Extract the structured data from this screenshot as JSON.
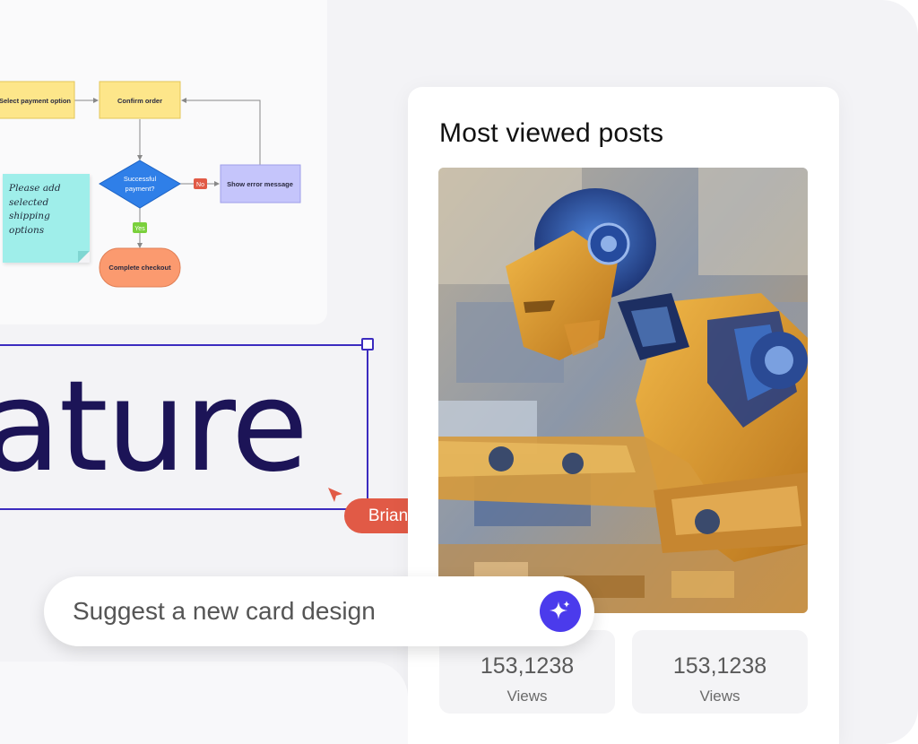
{
  "flowchart": {
    "nodes": {
      "select_payment": "Select payment option",
      "confirm_order": "Confirm order",
      "successful_payment_line1": "Successful",
      "successful_payment_line2": "payment?",
      "show_error": "Show error message",
      "complete_checkout": "Complete checkout"
    },
    "labels": {
      "no": "No",
      "yes": "Yes"
    },
    "colors": {
      "yellow": "#fde68a",
      "blue_diamond": "#2f7fe8",
      "lavender": "#c5c5fb",
      "orange": "#fb9a6f",
      "no_badge": "#e15a46",
      "yes_badge": "#7ad03c"
    }
  },
  "sticky_note": {
    "text": "Please add\nselected shipping\noptions",
    "color": "#9feeea"
  },
  "canvas_text": {
    "value": "ature",
    "frame_color": "#3b2bbf"
  },
  "collaborator": {
    "name": "Brian",
    "color": "#e15a46"
  },
  "posts_card": {
    "title": "Most viewed posts",
    "image_icon": "robot-artwork-image",
    "stats": [
      {
        "value": "153,1238",
        "label": "Views"
      },
      {
        "value": "153,1238",
        "label": "Views"
      }
    ]
  },
  "prompt_bar": {
    "placeholder": "Suggest a new card design",
    "button_icon": "sparkle-icon",
    "button_color": "#4b3bec"
  }
}
